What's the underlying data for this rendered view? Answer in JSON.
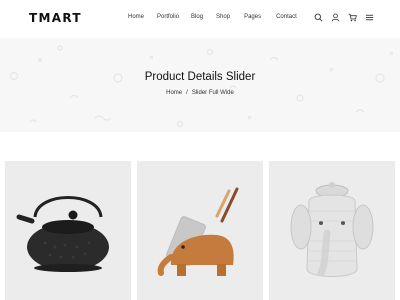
{
  "header": {
    "logo": "TMART",
    "nav": [
      "Home",
      "Portfolio",
      "Blog",
      "Shop",
      "Pages",
      "Contact"
    ],
    "icons": [
      "search-icon",
      "user-icon",
      "cart-icon",
      "menu-icon"
    ]
  },
  "hero": {
    "title": "Product Details Slider",
    "breadcrumb_home": "Home",
    "breadcrumb_separator": "/",
    "breadcrumb_current": "Slider Full Wide"
  },
  "products": [
    "teapot",
    "elephant-phone-stand",
    "woven-elephant-basket"
  ],
  "colors": {
    "hero_bg": "#f7f7f8",
    "card_bg": "#ececec",
    "text": "#222222"
  }
}
